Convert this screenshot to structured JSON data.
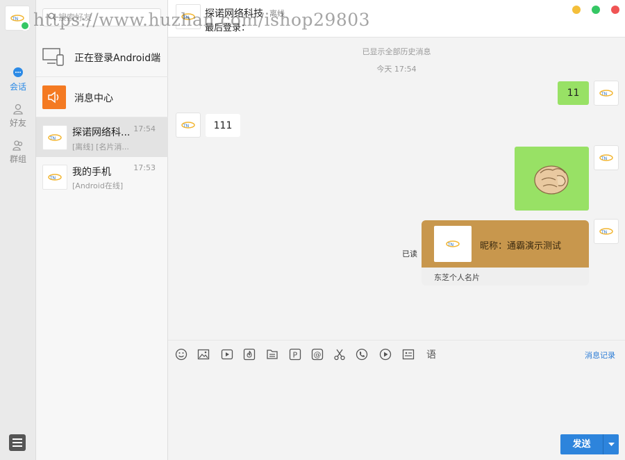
{
  "window": {
    "controls": [
      "minimize",
      "maximize",
      "close"
    ],
    "control_colors": [
      "#f4bf3a",
      "#35c764",
      "#f05454"
    ]
  },
  "rail": {
    "nav": [
      {
        "label": "会话",
        "icon": "chat-bubble-icon",
        "active": true
      },
      {
        "label": "好友",
        "icon": "user-icon",
        "active": false
      },
      {
        "label": "群组",
        "icon": "group-icon",
        "active": false
      }
    ]
  },
  "search": {
    "placeholder": "搜索好友"
  },
  "conversations": [
    {
      "name": "正在登录Android端",
      "icon": "device-icon"
    },
    {
      "name": "消息中心",
      "icon": "speaker-icon"
    },
    {
      "name": "探诺网络科...",
      "time": "17:54",
      "preview": "[离线] [名片消...",
      "selected": true
    },
    {
      "name": "我的手机",
      "time": "17:53",
      "preview": "[Android在线]"
    }
  ],
  "chat": {
    "title": "探诺网络科技",
    "tag": "离线",
    "subtitle": "最后登录：",
    "history_note": "已显示全部历史消息",
    "timestamp": "今天 17:54",
    "messages": [
      {
        "from": "me",
        "type": "text",
        "text": "11"
      },
      {
        "from": "peer",
        "type": "text",
        "text": "111"
      },
      {
        "from": "me",
        "type": "sticker",
        "sticker": "fist-emoji"
      },
      {
        "from": "me",
        "type": "card",
        "title": "昵称：通霸演示测试",
        "footer": "东芝个人名片",
        "read_status": "已读"
      }
    ]
  },
  "toolbar": {
    "tools": [
      "emoji-icon",
      "image-icon",
      "video-icon",
      "fire-icon",
      "file-icon",
      "parking-icon",
      "at-icon",
      "scissors-icon",
      "phone-icon",
      "play-icon",
      "card-icon",
      "voice-text-icon"
    ],
    "voice_label": "语",
    "history_link": "消息记录"
  },
  "composer": {
    "send_label": "发送"
  },
  "watermark": "https://www.huzhan.com/ishop29803"
}
